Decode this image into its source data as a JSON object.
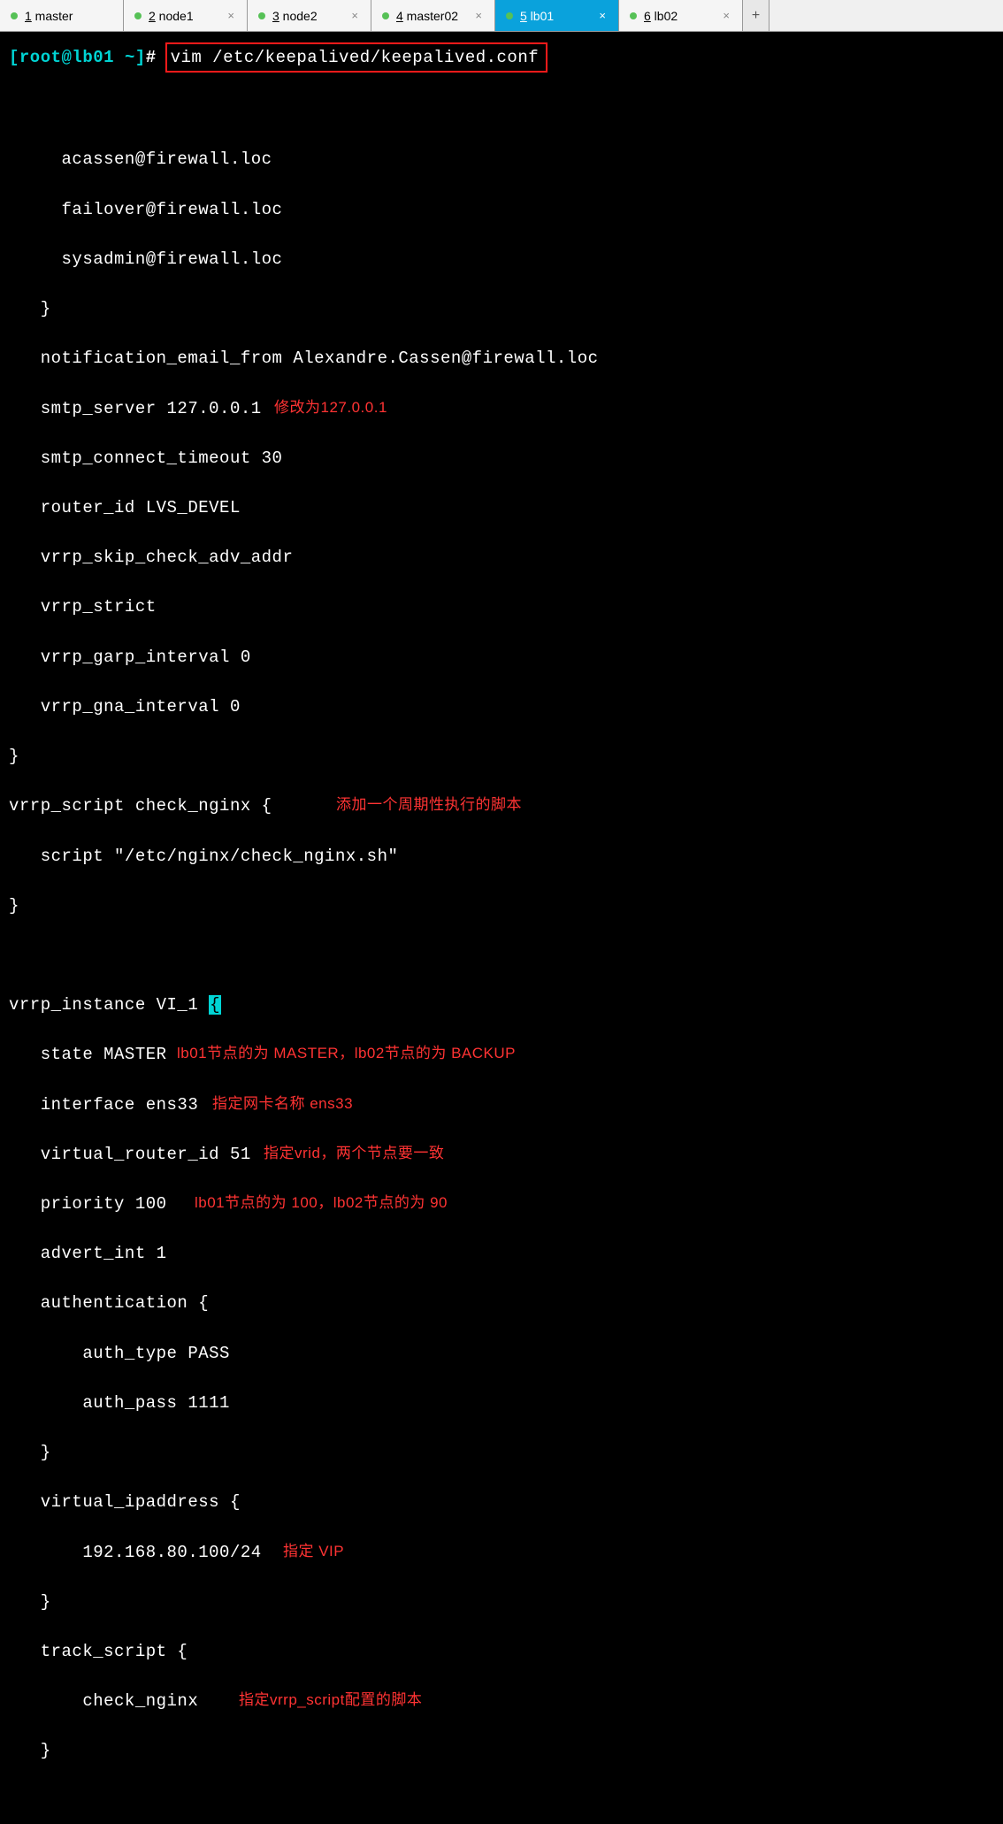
{
  "tabs": [
    {
      "num": "1",
      "label": "master",
      "active": false,
      "closable": false
    },
    {
      "num": "2",
      "label": "node1",
      "active": false,
      "closable": true
    },
    {
      "num": "3",
      "label": "node2",
      "active": false,
      "closable": true
    },
    {
      "num": "4",
      "label": "master02",
      "active": false,
      "closable": true
    },
    {
      "num": "5",
      "label": "lb01",
      "active": true,
      "closable": true
    },
    {
      "num": "6",
      "label": "lb02",
      "active": false,
      "closable": true
    }
  ],
  "add_tab": "+",
  "prompt": {
    "open": "[",
    "user": "root",
    "at": "@",
    "host": "lb01",
    "path": "~",
    "close": "]",
    "sym": "#"
  },
  "command": "vim /etc/keepalived/keepalived.conf",
  "config": {
    "email1": "     acassen@firewall.loc",
    "email2": "     failover@firewall.loc",
    "email3": "     sysadmin@firewall.loc",
    "email_close": "   }",
    "notif_from": "   notification_email_from Alexandre.Cassen@firewall.loc",
    "smtp_server": "   smtp_server 127.0.0.1",
    "smtp_timeout": "   smtp_connect_timeout 30",
    "router_id": "   router_id LVS_DEVEL",
    "skip_check": "   vrrp_skip_check_adv_addr",
    "vrrp_strict": "   vrrp_strict",
    "garp": "   vrrp_garp_interval 0",
    "gna": "   vrrp_gna_interval 0",
    "close1": "}",
    "script_open": "vrrp_script check_nginx {",
    "script_line": "   script \"/etc/nginx/check_nginx.sh\"",
    "script_close": "}",
    "instance_open_pre": "vrrp_instance VI_1 ",
    "instance_brace": "{",
    "state": "   state MASTER",
    "interface": "   interface ens33",
    "vrid": "   virtual_router_id 51",
    "priority": "   priority 100",
    "advert": "   advert_int 1",
    "auth_open": "   authentication {",
    "auth_type": "       auth_type PASS",
    "auth_pass": "       auth_pass 1111",
    "auth_close": "   }",
    "vip_open": "   virtual_ipaddress {",
    "vip": "       192.168.80.100/24",
    "vip_close": "   }",
    "track_open": "   track_script {",
    "track_name": "       check_nginx",
    "track_close": "   }"
  },
  "annotations": {
    "smtp": "修改为127.0.0.1",
    "script": "添加一个周期性执行的脚本",
    "state": "lb01节点的为 MASTER，lb02节点的为 BACKUP",
    "interface": "指定网卡名称 ens33",
    "vrid": "指定vrid，两个节点要一致",
    "priority": "lb01节点的为 100，lb02节点的为 90",
    "vip": "指定 VIP",
    "track": "指定vrrp_script配置的脚本"
  }
}
